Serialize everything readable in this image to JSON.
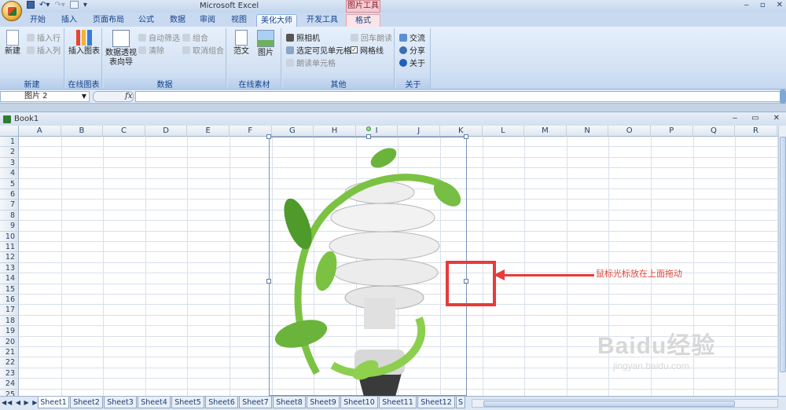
{
  "titlebar": {
    "app_title": "Microsoft Excel",
    "context_tab_group": "图片工具",
    "qat_items": [
      "save",
      "undo",
      "redo"
    ]
  },
  "tabs": [
    {
      "label": "开始"
    },
    {
      "label": "插入"
    },
    {
      "label": "页面布局"
    },
    {
      "label": "公式"
    },
    {
      "label": "数据"
    },
    {
      "label": "审阅"
    },
    {
      "label": "视图"
    },
    {
      "label": "美化大师",
      "active": true
    },
    {
      "label": "开发工具"
    },
    {
      "label": "格式",
      "context": true
    }
  ],
  "ribbon": {
    "new_group": {
      "label": "新建",
      "new_btn": "新建",
      "insert_row": "插入行",
      "insert_col": "插入列"
    },
    "online_chart_group": {
      "label": "在线图表",
      "insert_chart": "插入图表"
    },
    "data_group": {
      "label": "数据",
      "pivot_wizard_line1": "数据透视",
      "pivot_wizard_line2": "表向导",
      "auto_filter": "自动筛选",
      "clear": "清除",
      "group": "组合",
      "ungroup": "取消组合"
    },
    "online_material_group": {
      "label": "在线素材",
      "template": "范文",
      "picture": "图片"
    },
    "other_group": {
      "label": "其他",
      "camera": "照相机",
      "select_visible": "选定可见单元格",
      "read_cells": "朗读单元格",
      "enter_read": "回车朗读",
      "gridlines": "网格线"
    },
    "about_group": {
      "label": "关于",
      "exchange": "交流",
      "share": "分享",
      "about": "关于"
    }
  },
  "formula_bar": {
    "name_box": "图片 2",
    "fx": "fx",
    "formula": ""
  },
  "workbook": {
    "title": "Book1"
  },
  "columns": [
    "A",
    "B",
    "C",
    "D",
    "E",
    "F",
    "G",
    "H",
    "I",
    "J",
    "K",
    "L",
    "M",
    "N",
    "O",
    "P",
    "Q",
    "R"
  ],
  "rows": [
    "1",
    "2",
    "3",
    "4",
    "5",
    "6",
    "7",
    "8",
    "9",
    "10",
    "11",
    "12",
    "13",
    "14",
    "15",
    "16",
    "17",
    "18",
    "19",
    "20",
    "21",
    "22",
    "23",
    "24",
    "25"
  ],
  "sheets": [
    "Sheet1",
    "Sheet2",
    "Sheet3",
    "Sheet4",
    "Sheet5",
    "Sheet6",
    "Sheet7",
    "Sheet8",
    "Sheet9",
    "Sheet10",
    "Sheet11",
    "Sheet12",
    "S"
  ],
  "active_sheet": "Sheet1",
  "annotation": {
    "text": "鼠标光标放在上面拖动",
    "color": "#e63b3b"
  },
  "watermark": {
    "brand": "Baidu经验",
    "url": "jingyan.baidu.com"
  },
  "colors": {
    "ribbon_bg": "#d2e1f3",
    "accent": "#15428b",
    "highlight": "#e63b3b"
  }
}
